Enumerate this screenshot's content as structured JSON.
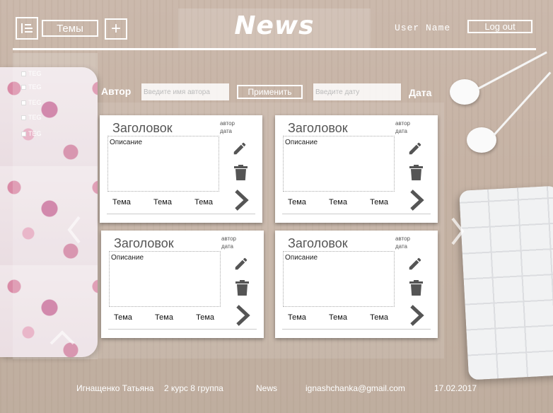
{
  "header": {
    "topics_label": "Темы",
    "add_label": "+",
    "logo": "News",
    "user_name": "User Name",
    "logout_label": "Log out"
  },
  "sidebar": {
    "tags": [
      "TEG",
      "TEG",
      "TEG",
      "TEG",
      "TEG"
    ]
  },
  "filters": {
    "author_label": "Автор",
    "author_placeholder": "Введите имя автора",
    "apply_label": "Применить",
    "date_placeholder": "Введите дату",
    "date_label": "Дата"
  },
  "cards": [
    {
      "title": "Заголовок",
      "author": "автор",
      "date": "дата",
      "description": "Описание",
      "topics": [
        "Тема",
        "Тема",
        "Тема"
      ]
    },
    {
      "title": "Заголовок",
      "author": "автор",
      "date": "дата",
      "description": "Описание",
      "topics": [
        "Тема",
        "Тема",
        "Тема"
      ]
    },
    {
      "title": "Заголовок",
      "author": "автор",
      "date": "дата",
      "description": "Описание",
      "topics": [
        "Тема",
        "Тема",
        "Тема"
      ]
    },
    {
      "title": "Заголовок",
      "author": "автор",
      "date": "дата",
      "description": "Описание",
      "topics": [
        "Тема",
        "Тема",
        "Тема"
      ]
    }
  ],
  "icons": {
    "menu": "menu-icon",
    "edit": "pencil-icon",
    "delete": "trash-icon",
    "open": "chevron-right-icon",
    "prev": "chevron-left-icon",
    "next": "chevron-right-icon",
    "up": "chevron-up-icon"
  },
  "footer": {
    "author": "Игнащенко Татьяна",
    "group": "2 курс 8 группа",
    "site": "News",
    "email": "ignashchanka@gmail.com",
    "date": "17.02.2017"
  },
  "colors": {
    "accent": "#ffffff",
    "icon": "#555555",
    "card_bg": "#ffffff"
  }
}
